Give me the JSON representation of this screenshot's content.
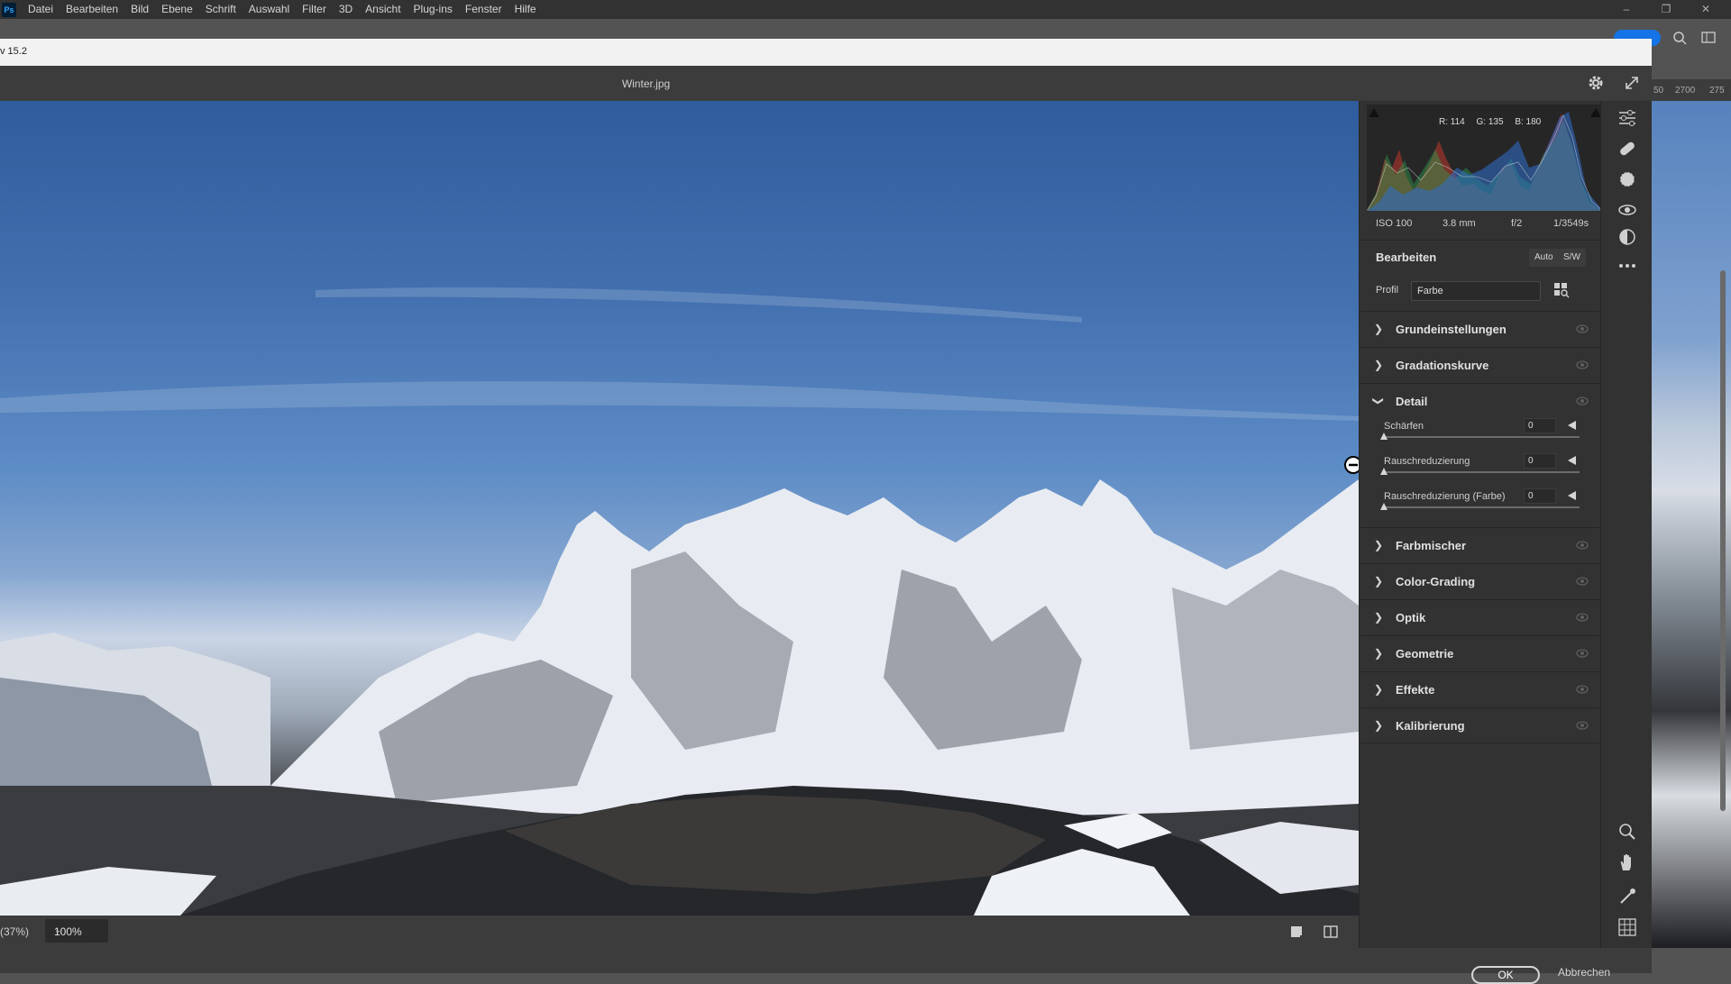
{
  "app": {
    "menu": [
      "Datei",
      "Bearbeiten",
      "Bild",
      "Ebene",
      "Schrift",
      "Auswahl",
      "Filter",
      "3D",
      "Ansicht",
      "Plug-ins",
      "Fenster",
      "Hilfe"
    ],
    "logo": "Ps"
  },
  "camera_raw": {
    "title": "v 15.2",
    "filename": "Winter.jpg"
  },
  "histogram": {
    "r_label": "R: 114",
    "g_label": "G: 135",
    "b_label": "B: 180"
  },
  "exif": {
    "iso": "ISO 100",
    "focal": "3.8 mm",
    "aperture": "f/2",
    "shutter": "1/3549s"
  },
  "edit": {
    "title": "Bearbeiten",
    "auto_label": "Auto",
    "bw_label": "S/W",
    "profile_label": "Profil",
    "profile_value": "Farbe"
  },
  "sections": {
    "basic": "Grundeinstellungen",
    "curve": "Gradationskurve",
    "detail": "Detail",
    "mixer": "Farbmischer",
    "grading": "Color-Grading",
    "optics": "Optik",
    "geometry": "Geometrie",
    "effects": "Effekte",
    "calibration": "Kalibrierung"
  },
  "detail_sliders": {
    "sharpen_label": "Schärfen",
    "sharpen_value": "0",
    "noise_label": "Rauschreduzierung",
    "noise_value": "0",
    "color_noise_label": "Rauschreduzierung (Farbe)",
    "color_noise_value": "0"
  },
  "status": {
    "zoom_outer": "(37%)",
    "zoom_value": "100%"
  },
  "dialog": {
    "ok_label": "OK",
    "cancel_label": "Abbrechen"
  },
  "ruler": {
    "tick_a": "50",
    "tick_b": "2700",
    "tick_c": "275"
  },
  "colors": {
    "accent": "#1473e6",
    "panel_bg": "#323232",
    "menubar_bg": "#323232"
  }
}
